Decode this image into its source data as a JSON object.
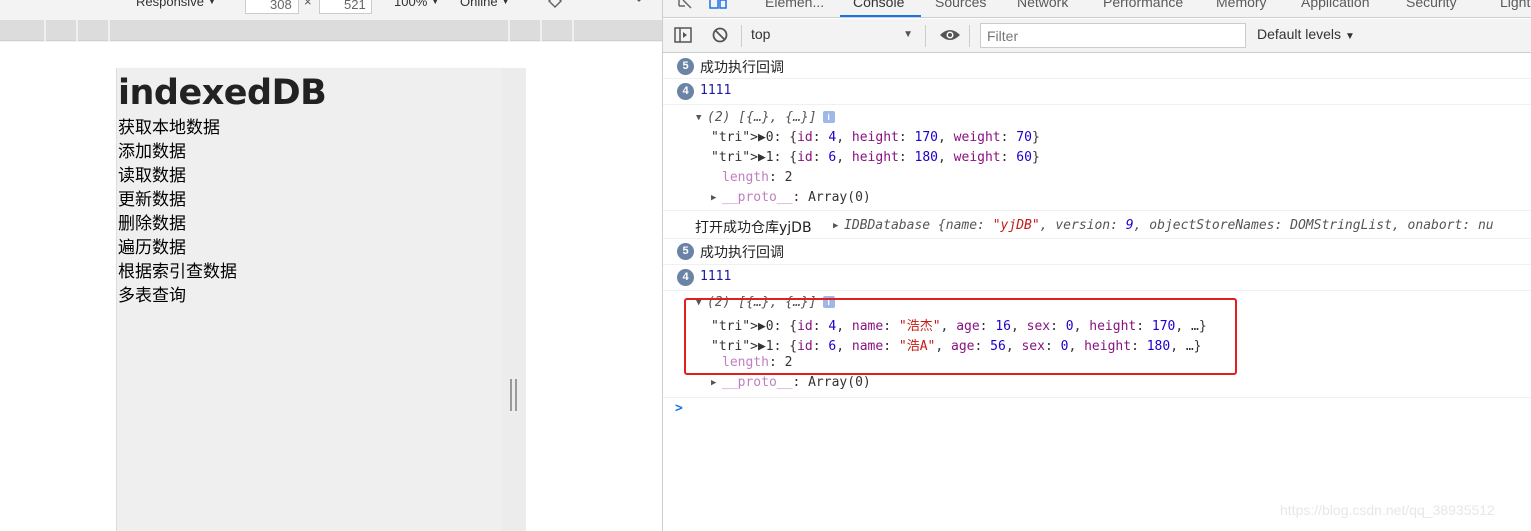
{
  "device_toolbar": {
    "device_label": "Responsive",
    "width_value": "308",
    "times_symbol": "×",
    "height_value": "521",
    "zoom_label": "100%",
    "throttle_label": "Online"
  },
  "page": {
    "heading": "indexedDB",
    "links": [
      "获取本地数据",
      "添加数据",
      "读取数据",
      "更新数据",
      "删除数据",
      "遍历数据",
      "根据索引查数据",
      "多表查询"
    ]
  },
  "devtools": {
    "tabs": [
      "Elemen...",
      "Console",
      "Sources",
      "Network",
      "Performance",
      "Memory",
      "Application",
      "Security",
      "Lighth"
    ],
    "active_tab": "Console",
    "context": "top",
    "filter_placeholder": "Filter",
    "levels_label": "Default levels"
  },
  "console": {
    "messages": [
      {
        "badge": "5",
        "text": "成功执行回调"
      },
      {
        "badge": "4",
        "text": "1111"
      },
      {
        "summary": "(2) [{…}, {…}]",
        "info": "i",
        "rows": [
          "▶0: {id: 4, height: 170, weight: 70}",
          "▶1: {id: 6, height: 180, weight: 60}"
        ],
        "length_key": "length",
        "length_value": "2",
        "proto_key": "__proto__",
        "proto_value": "Array(0)"
      },
      {
        "text": "打开成功仓库yjDB",
        "object": "IDBDatabase {name: \"yjDB\", version: 9, objectStoreNames: DOMStringList, onabort: nu"
      },
      {
        "badge": "5",
        "text": "成功执行回调"
      },
      {
        "badge": "4",
        "text": "1111"
      },
      {
        "summary": "(2) [{…}, {…}]",
        "info": "i",
        "rows": [
          "▶0: {id: 4, name: \"浩杰\", age: 16, sex: 0, height: 170, …}",
          "▶1: {id: 6, name: \"浩A\", age: 56, sex: 0, height: 180, …}"
        ],
        "length_key": "length",
        "length_value": "2",
        "proto_key": "__proto__",
        "proto_value": "Array(0)"
      }
    ],
    "prompt": ">"
  },
  "watermark": "https://blog.csdn.net/qq_38935512",
  "colors": {
    "accent": "#1a73e8",
    "highlight": "#e0201d",
    "badge": "#6b83a4"
  }
}
